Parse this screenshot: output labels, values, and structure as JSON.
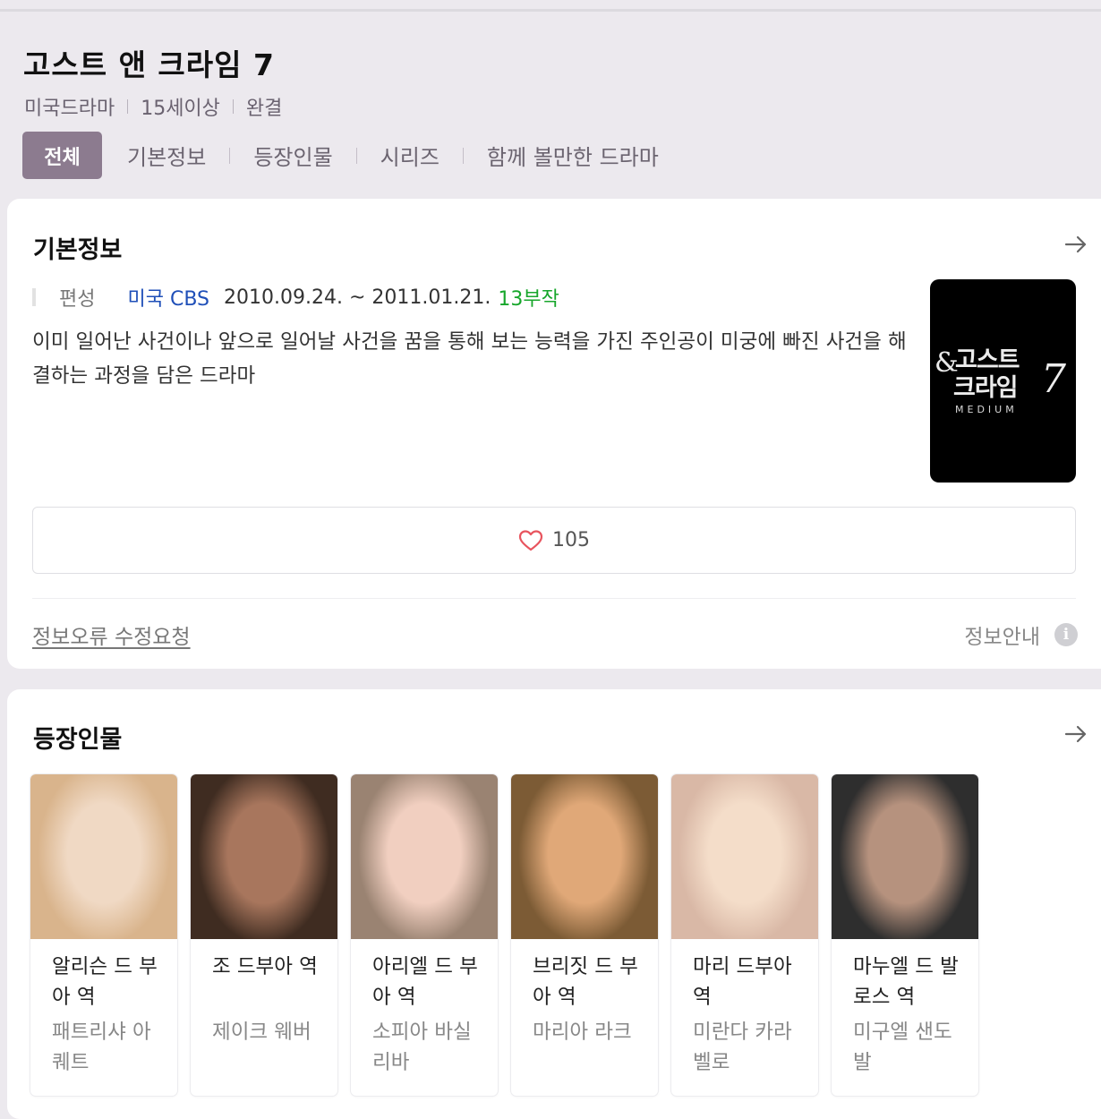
{
  "header": {
    "title": "고스트 앤 크라임 7",
    "meta": [
      "미국드라마",
      "15세이상",
      "완결"
    ],
    "tabs": [
      {
        "label": "전체",
        "active": true
      },
      {
        "label": "기본정보"
      },
      {
        "label": "등장인물"
      },
      {
        "label": "시리즈"
      },
      {
        "label": "함께 볼만한 드라마"
      }
    ]
  },
  "basic_info": {
    "title": "기본정보",
    "label": "편성",
    "network": "미국 CBS",
    "dates": "2010.09.24. ~ 2011.01.21.",
    "episodes": "13부작",
    "description": "이미 일어난 사건이나 앞으로 일어날 사건을 꿈을 통해 보는 능력을 가진 주인공이 미궁에 빠진 사건을 해결하는 과정을 담은 드라마",
    "poster": {
      "amp": "&",
      "line1": "고스트",
      "line2": "크라임",
      "number": "7",
      "subtitle": "MEDIUM"
    },
    "likes": "105",
    "edit_link": "정보오류 수정요청",
    "info_guide": "정보안내",
    "info_icon": "i"
  },
  "cast_section": {
    "title": "등장인물",
    "members": [
      {
        "role": "알리슨 드 부아 역",
        "actor": "패트리샤 아퀘트",
        "colors": [
          "#d9b48c",
          "#f0d9c4"
        ]
      },
      {
        "role": "조 드부아 역",
        "actor": "제이크 웨버",
        "colors": [
          "#3f2c21",
          "#a8765d"
        ]
      },
      {
        "role": "아리엘 드 부아 역",
        "actor": "소피아 바실리바",
        "colors": [
          "#9a8372",
          "#f1cfc0"
        ]
      },
      {
        "role": "브리짓 드 부아 역",
        "actor": "마리아 라크",
        "colors": [
          "#7c5b35",
          "#e0a878"
        ]
      },
      {
        "role": "마리 드부아 역",
        "actor": "미란다 카라벨로",
        "colors": [
          "#d9b8a6",
          "#f4ddc9"
        ]
      },
      {
        "role": "마누엘 드 발로스 역",
        "actor": "미구엘 샌도발",
        "colors": [
          "#2e2e2e",
          "#b6927e"
        ]
      }
    ]
  },
  "colors": {
    "accent": "#8c7b8f",
    "network": "#1f4fb8",
    "episodes": "#17a62b",
    "heart": "#e8545e"
  }
}
